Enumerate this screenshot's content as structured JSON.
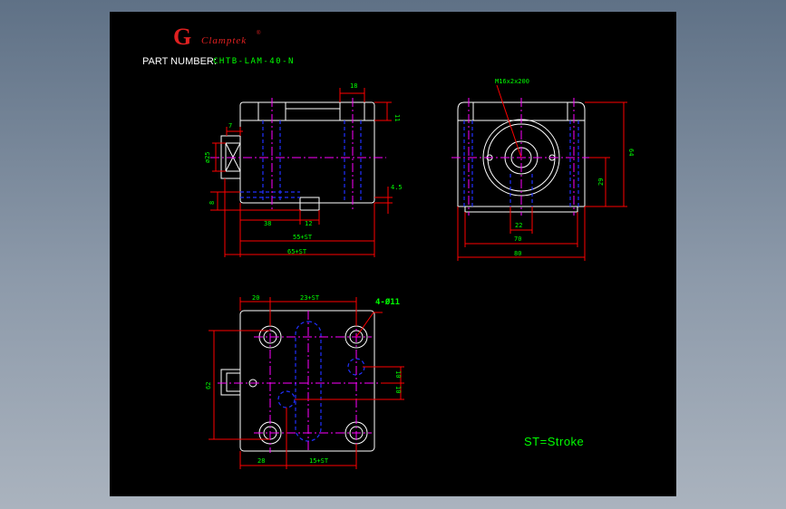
{
  "title_block": {
    "brand_letter": "G",
    "brand_name": "Clamptek",
    "registered": "®",
    "part_number_label": "PART NUMBER:",
    "part_number": "CHTB-LAM-40-N"
  },
  "front_view": {
    "dims": [
      "18",
      "11",
      "7",
      "ø25",
      "8",
      "4.5",
      "38",
      "12",
      "55+ST",
      "65+ST"
    ]
  },
  "side_view": {
    "thread_callout": "M16x2x200",
    "dims": [
      "64",
      "29",
      "22",
      "70",
      "80"
    ]
  },
  "top_view": {
    "hole_callout": "4-Ø11",
    "dims": [
      "20",
      "23+ST",
      "62",
      "10",
      "10",
      "28",
      "15+ST"
    ]
  },
  "note": "ST=Stroke",
  "colors": {
    "background": "#000000",
    "outline": "#ffffff",
    "dimension": "#ff0000",
    "centerline": "#ff00ff",
    "hidden": "#0000ff",
    "text": "#00ff00",
    "brand": "#e02020"
  }
}
